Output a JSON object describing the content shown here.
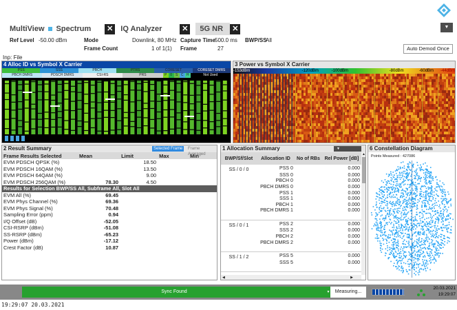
{
  "toolbar": {
    "tabs": [
      {
        "label": "MultiView",
        "icon": "multiview-icon"
      },
      {
        "label": "Spectrum"
      },
      {
        "label": "IQ Analyzer"
      },
      {
        "label": "5G NR"
      }
    ]
  },
  "settings": {
    "ref_level_label": "Ref Level",
    "ref_level_value": "-50.00 dBm",
    "mode_label": "Mode",
    "mode_value": "Downlink, 80 MHz",
    "capture_time_label": "Capture Time",
    "capture_time_value": "500.0 ms",
    "bwp_ss_label": "BWP/SS",
    "bwp_ss_value": "All",
    "frame_count_label": "Frame Count",
    "frame_count_value": "1 of 1(1)",
    "frame_label": "Frame",
    "frame_value": "27",
    "auto_demod_label": "Auto Demod Once",
    "input_label": "Inp: File"
  },
  "win4": {
    "title": "4 Alloc ID vs Symbol X Carrier",
    "legend_row1": [
      "PSS",
      "SSS",
      "PBCH",
      "PTRS",
      "CORESET",
      "CORESET DMRS"
    ],
    "legend_row2": [
      "PBCH DMRS",
      "PDSCH DMRS",
      "CSI-RS",
      "PRS",
      "P",
      "0",
      "S",
      "C",
      "H",
      "Not Used"
    ]
  },
  "win3": {
    "title": "3 Power vs Symbol X Carrier",
    "scale": [
      "-153dBm",
      "-120dBm",
      "-100dBm",
      "-80dBm",
      "-60dBm",
      "-44dBm"
    ]
  },
  "win2": {
    "title": "2 Result Summary",
    "btn_selected_frame": "Selected Frame",
    "btn_frame_averaged": "Frame Averaged",
    "headers": [
      "Frame Results Selected",
      "Mean",
      "Limit",
      "Max",
      "Min"
    ],
    "rows_a": [
      {
        "name": "EVM PDSCH QPSK (%)",
        "mean": "",
        "limit": "18.50"
      },
      {
        "name": "EVM PDSCH 16QAM (%)",
        "mean": "",
        "limit": "13.50"
      },
      {
        "name": "EVM PDSCH 64QAM (%)",
        "mean": "",
        "limit": "9.00"
      },
      {
        "name": "EVM PDSCH 256QAM (%)",
        "mean": "78.30",
        "limit": "4.50"
      }
    ],
    "section_b": "Results for Selection  BWP/SS All,  Subframe All,  Slot All",
    "rows_b": [
      {
        "name": "EVM All (%)",
        "mean": "69.45"
      },
      {
        "name": "EVM Phys Channel (%)",
        "mean": "69.36"
      },
      {
        "name": "EVM Phys Signal (%)",
        "mean": "70.48"
      },
      {
        "name": "Sampling Error (ppm)",
        "mean": "0.94"
      },
      {
        "name": "I/Q Offset (dB)",
        "mean": "-52.05"
      },
      {
        "name": "CSI-RSRP (dBm)",
        "mean": "-51.08"
      },
      {
        "name": "SS-RSRP (dBm)",
        "mean": "-65.23"
      },
      {
        "name": "Power (dBm)",
        "mean": "-17.12"
      },
      {
        "name": "Crest Factor (dB)",
        "mean": "10.87"
      }
    ]
  },
  "win1": {
    "title": "1 Allocation Summary",
    "headers": [
      "BWP/Sf/Slot",
      "Allocation ID",
      "No of RBs",
      "Rel Power [dB]"
    ],
    "groups": [
      {
        "slot": "SS / 0 / 0",
        "rows": [
          {
            "id": "PSS 0",
            "pwr": "0.000"
          },
          {
            "id": "SSS 0",
            "pwr": "0.000"
          },
          {
            "id": "PBCH 0",
            "pwr": "0.000"
          },
          {
            "id": "PBCH DMRS 0",
            "pwr": "0.000"
          },
          {
            "id": "PSS 1",
            "pwr": "0.000"
          },
          {
            "id": "SSS 1",
            "pwr": "0.000"
          },
          {
            "id": "PBCH 1",
            "pwr": "0.000"
          },
          {
            "id": "PBCH DMRS 1",
            "pwr": "0.000"
          }
        ]
      },
      {
        "slot": "SS / 0 / 1",
        "rows": [
          {
            "id": "PSS 2",
            "pwr": "0.000"
          },
          {
            "id": "SSS 2",
            "pwr": "0.000"
          },
          {
            "id": "PBCH 2",
            "pwr": "0.000"
          },
          {
            "id": "PBCH DMRS 2",
            "pwr": "0.000"
          }
        ]
      },
      {
        "slot": "SS / 1 / 2",
        "rows": [
          {
            "id": "PSS 5",
            "pwr": "0.000"
          },
          {
            "id": "SSS 5",
            "pwr": "0.000"
          }
        ]
      }
    ]
  },
  "win6": {
    "title": "6 Constellation Diagram",
    "points_label": "Points Measured : 427086"
  },
  "status": {
    "sync": "Sync Found",
    "measuring": "Measuring...",
    "date": "20.03.2021",
    "time": "19:29:07",
    "bottom_timestamp": "19:29:07  20.03.2021"
  },
  "colors": {
    "title_blue": "#0a47a6",
    "sync_green": "#27a12f",
    "constellation": "#2aa6f5"
  }
}
